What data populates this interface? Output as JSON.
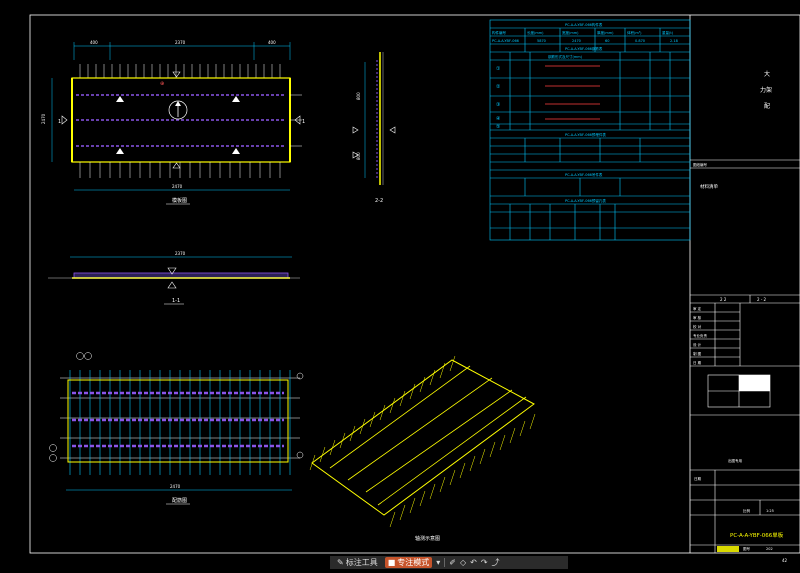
{
  "titleblock": {
    "company_line1": "大",
    "company_line2": "力架",
    "company_line3": "配",
    "small_label": "图纸编号",
    "note_label": "材料清单",
    "mid_header_a": "2 2",
    "mid_header_b": "2 - 2",
    "rows_left": [
      "审 定",
      "审 核",
      "校 对",
      "专业负责",
      "设 计",
      "制 图",
      "日 期"
    ],
    "stamp_label": "出图专用",
    "date_label": "日期",
    "scale_label": "比例",
    "scale_value": "1:25",
    "drawing_title": "PC-A-A-YBF-066单板",
    "sheet_label": "图号",
    "sheet_value": "202",
    "page_no": "42"
  },
  "tables": {
    "t1_title": "PC-A-A-YBF-066构件表",
    "t1_headers": [
      "构件编号",
      "长度(mm)",
      "宽度(mm)",
      "厚度(mm)",
      "体积(m³)",
      "重量(t)"
    ],
    "t1_row": [
      "PC-A-A-YBF-066",
      "5870",
      "2470",
      "60",
      "0.870",
      "2.18"
    ],
    "t2_title": "PC-A-A-YBF-066钢筋表",
    "t2_header": "钢筋形式及尺寸(mm)",
    "t2_ids": [
      "①",
      "②",
      "③",
      "④",
      "⑤"
    ],
    "t3_title": "PC-A-A-YBF-066预埋件表",
    "t4_title": "PC-A-A-YBF-066吊件表",
    "t5_title": "PC-A-A-YBF-066预留孔表"
  },
  "views": {
    "plan_label": "模板图",
    "section_11": "1-1",
    "section_22": "2-2",
    "rebar_label": "配筋图",
    "iso_label": "轴测示意图"
  },
  "toolbar": {
    "items": [
      "标注工具",
      "专注模式"
    ],
    "icons": [
      "pen-icon",
      "shape-icon",
      "undo-icon",
      "redo-icon",
      "share-icon"
    ]
  },
  "colors": {
    "cyan": "#00c8ff",
    "yellow": "#ffff00",
    "purple": "#8a55e8",
    "white": "#ffffff",
    "accent": "#c6542b"
  }
}
